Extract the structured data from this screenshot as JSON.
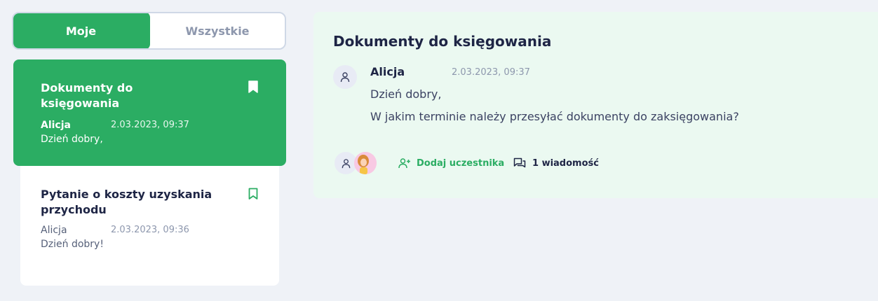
{
  "tabs": {
    "mine": "Moje",
    "all": "Wszystkie"
  },
  "threads": [
    {
      "title": "Dokumenty do księgowania",
      "author": "Alicja",
      "date": "2.03.2023, 09:37",
      "preview": "Dzień dobry,"
    },
    {
      "title": "Pytanie o koszty uzyskania przychodu",
      "author": "Alicja",
      "date": "2.03.2023, 09:36",
      "preview": "Dzień dobry!"
    }
  ],
  "detail": {
    "title": "Dokumenty do księgowania",
    "message": {
      "author": "Alicja",
      "date": "2.03.2023, 09:37",
      "line1": "Dzień dobry,",
      "line2": "W jakim terminie należy przesyłać dokumenty do zaksięgowania?"
    },
    "add_participant": "Dodaj uczestnika",
    "messages_count": "1 wiadomość"
  },
  "colors": {
    "accent": "#2bad63",
    "background": "#eff2f7",
    "detail_bg": "#ebf9f1"
  },
  "icons": [
    "bookmark-filled-icon",
    "bookmark-outline-icon",
    "user-icon",
    "add-user-icon",
    "chat-bubbles-icon"
  ]
}
